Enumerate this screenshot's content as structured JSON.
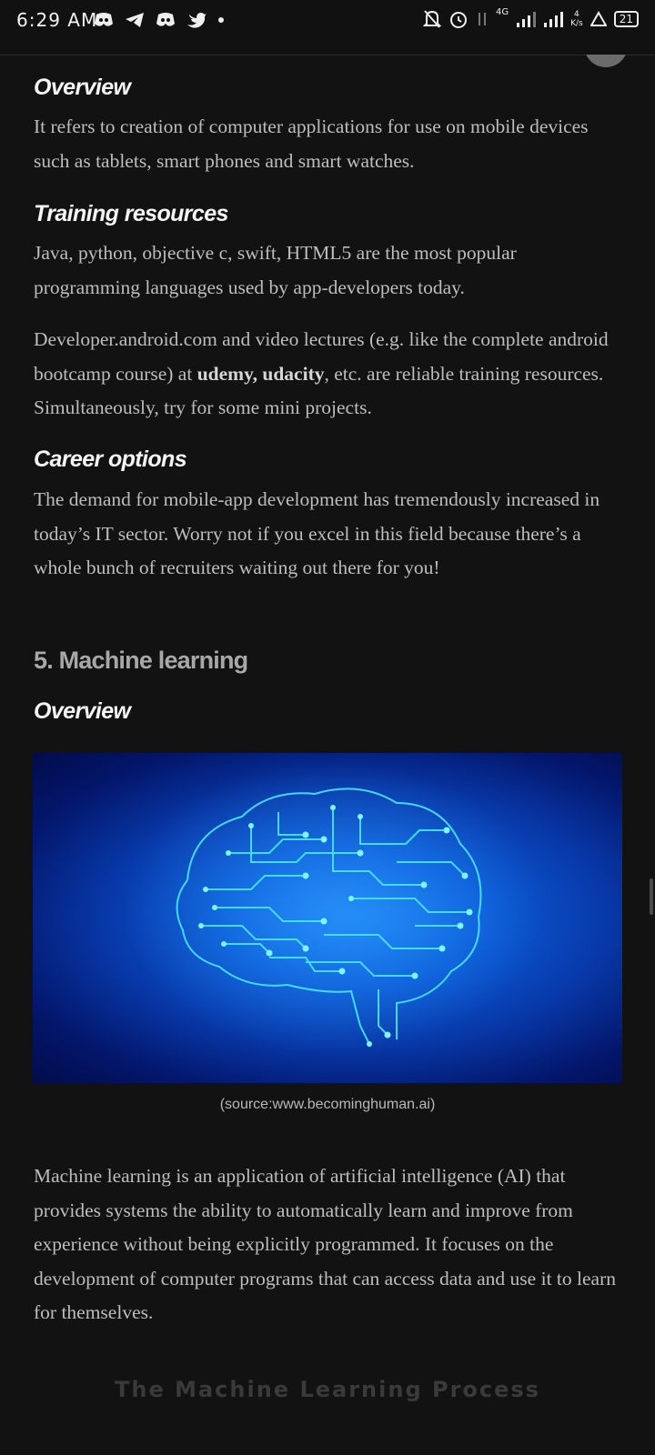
{
  "status_bar": {
    "time": "6:29 AM",
    "network_type": "4G",
    "speed": "4",
    "speed_unit": "K/s",
    "battery": "21",
    "left_icons": [
      "discord-icon",
      "telegram-icon",
      "discord-icon",
      "twitter-icon",
      "dot-icon"
    ],
    "right_icons": [
      "notifications-off-icon",
      "alarm-icon",
      "data-arrows-icon",
      "signal-icon",
      "signal-icon",
      "warning-icon",
      "battery-icon"
    ]
  },
  "article": {
    "overview1_heading": "Overview",
    "overview1_text": "It refers to creation of computer applications for use on mobile devices such as tablets, smart phones and smart watches.",
    "training_heading": "Training resources",
    "training_text": "Java, python, objective c, swift, HTML5 are the most popular programming languages used by app-developers today.",
    "training_text2_before": "Developer.android.com and video lectures (e.g. like the complete android bootcamp course) at ",
    "training_text2_bold": "udemy, udacity",
    "training_text2_after": ", etc. are reliable training resources. Simultaneously, try for some mini projects.",
    "career_heading": "Career options",
    "career_text": "The demand for mobile-app development has tremendously increased in today’s IT sector. Worry not if you excel in this field because there’s a whole bunch of recruiters waiting out there for you!",
    "section_heading": "5. Machine learning",
    "overview2_heading": "Overview",
    "figure_caption": "(source:www.becominghuman.ai)",
    "ml_text": "Machine learning is an application of artificial intelligence (AI) that provides systems the ability to automatically learn and improve from experience without being explicitly programmed. It focuses on the development of computer programs that can access data and use it to learn for themselves.",
    "next_figure_title": "The Machine Learning Process"
  },
  "colors": {
    "background": "#121212",
    "heading": "#f5f5f5",
    "body_text": "#bdbdbd",
    "section_heading": "#a8a8a8",
    "figure_glow": "#3ff2ff"
  }
}
